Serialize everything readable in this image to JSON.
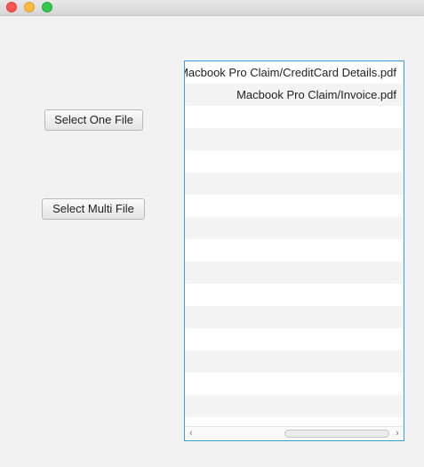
{
  "window": {
    "traffic_lights": [
      "close",
      "minimize",
      "zoom"
    ]
  },
  "buttons": {
    "select_one": "Select One File",
    "select_multi": "Select Multi File"
  },
  "file_list": {
    "items": [
      "Macbook Pro Claim/CreditCard Details.pdf",
      "Macbook Pro Claim/Invoice.pdf",
      "",
      "",
      "",
      "",
      "",
      "",
      "",
      "",
      "",
      "",
      "",
      "",
      "",
      ""
    ],
    "accent_color": "#3b9fd8"
  }
}
